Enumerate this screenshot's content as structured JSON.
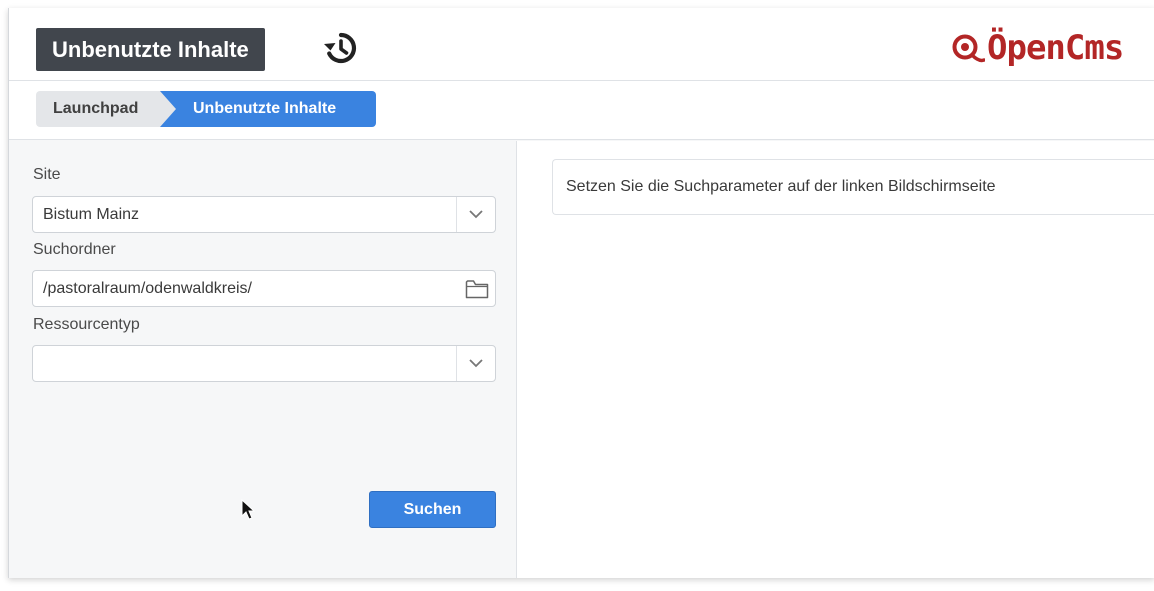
{
  "header": {
    "title": "Unbenutzte Inhalte",
    "history_icon": "history-icon",
    "logo_text": "ÖpenCms"
  },
  "breadcrumb": {
    "items": [
      {
        "label": "Launchpad"
      },
      {
        "label": "Unbenutzte Inhalte"
      }
    ]
  },
  "form": {
    "site": {
      "label": "Site",
      "value": "Bistum Mainz"
    },
    "folder": {
      "label": "Suchordner",
      "value": "/pastoralraum/odenwaldkreis/"
    },
    "resource_type": {
      "label": "Ressourcentyp",
      "value": ""
    },
    "search_label": "Suchen"
  },
  "results": {
    "message": "Setzen Sie die Suchparameter auf der linken Bildschirmseite"
  },
  "colors": {
    "accent": "#3a83e0",
    "title_bg": "#41464d",
    "logo": "#b32626"
  }
}
